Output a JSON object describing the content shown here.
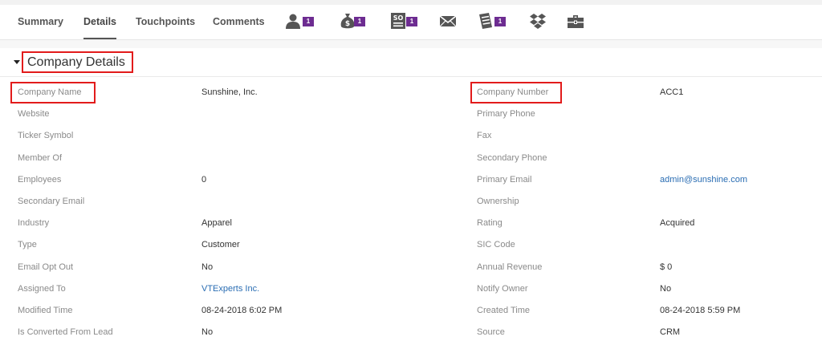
{
  "tabs": [
    {
      "label": "Summary",
      "active": false
    },
    {
      "label": "Details",
      "active": true
    },
    {
      "label": "Touchpoints",
      "active": false
    },
    {
      "label": "Comments",
      "active": false
    }
  ],
  "toolbar_icons": [
    {
      "icon": "contacts-icon",
      "badge": "1"
    },
    {
      "icon": "money-bag-icon",
      "badge": "1"
    },
    {
      "icon": "sales-order-icon",
      "badge": "1"
    },
    {
      "icon": "envelope-icon",
      "badge": ""
    },
    {
      "icon": "invoice-icon",
      "badge": "1"
    },
    {
      "icon": "dropbox-icon",
      "badge": ""
    },
    {
      "icon": "briefcase-icon",
      "badge": ""
    }
  ],
  "colors": {
    "badge": "#6d2c91",
    "highlight": "#e21b1b",
    "link": "#2a6db3"
  },
  "section": {
    "title": "Company Details"
  },
  "fields": [
    [
      {
        "label": "Company Name",
        "value": ""
      },
      {
        "label": "Sunshine, Inc.",
        "value": ""
      }
    ],
    [],
    [],
    [],
    [],
    [],
    [],
    [],
    [],
    [],
    [],
    []
  ],
  "rows": [
    {
      "left": {
        "label": "Company Name",
        "value": "Sunshine, Inc."
      },
      "right": {
        "label": "Company Number",
        "value": "ACC1"
      }
    },
    {
      "left": {
        "label": "Website",
        "value": ""
      },
      "right": {
        "label": "Primary Phone",
        "value": ""
      }
    },
    {
      "left": {
        "label": "Ticker Symbol",
        "value": ""
      },
      "right": {
        "label": "Fax",
        "value": ""
      }
    },
    {
      "left": {
        "label": "Member Of",
        "value": ""
      },
      "right": {
        "label": "Secondary Phone",
        "value": ""
      }
    },
    {
      "left": {
        "label": "Employees",
        "value": "0"
      },
      "right": {
        "label": "Primary Email",
        "value": "admin@sunshine.com",
        "link": true
      }
    },
    {
      "left": {
        "label": "Secondary Email",
        "value": ""
      },
      "right": {
        "label": "Ownership",
        "value": ""
      }
    },
    {
      "left": {
        "label": "Industry",
        "value": "Apparel"
      },
      "right": {
        "label": "Rating",
        "value": "Acquired"
      }
    },
    {
      "left": {
        "label": "Type",
        "value": "Customer"
      },
      "right": {
        "label": "SIC Code",
        "value": ""
      }
    },
    {
      "left": {
        "label": "Email Opt Out",
        "value": "No"
      },
      "right": {
        "label": "Annual Revenue",
        "value": "$ 0"
      }
    },
    {
      "left": {
        "label": "Assigned To",
        "value": "VTExperts Inc.",
        "link": true
      },
      "right": {
        "label": "Notify Owner",
        "value": "No"
      }
    },
    {
      "left": {
        "label": "Modified Time",
        "value": "08-24-2018 6:02 PM"
      },
      "right": {
        "label": "Created Time",
        "value": "08-24-2018 5:59 PM"
      }
    },
    {
      "left": {
        "label": "Is Converted From Lead",
        "value": "No"
      },
      "right": {
        "label": "Source",
        "value": "CRM"
      }
    }
  ]
}
